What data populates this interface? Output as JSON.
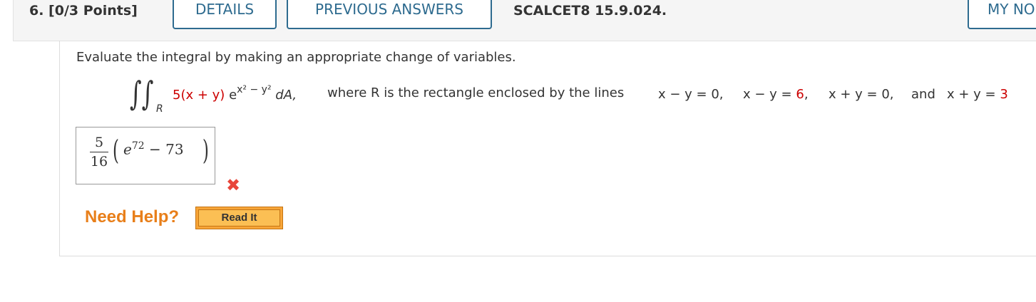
{
  "question": {
    "number_points": "6.  [0/3 Points]",
    "details_label": "DETAILS",
    "previous_answers_label": "PREVIOUS ANSWERS",
    "source": "SCALCET8 15.9.024.",
    "my_notes_label": "MY NO"
  },
  "problem": {
    "prompt": "Evaluate the integral by making an appropriate change of variables.",
    "integral_subscript": "R",
    "integrand_coef": "5(x + y)",
    "integrand_e": "e",
    "integrand_exp": "x² − y²",
    "integrand_dA": " dA,",
    "where_text": "where R is the rectangle enclosed by the lines",
    "line1": "x − y = 0,",
    "line2_left": "x − y = ",
    "line2_value": "6",
    "line2_comma": ",",
    "line3": "x + y = 0,",
    "and_text": "and",
    "line4_left": "x + y = ",
    "line4_value": "3"
  },
  "answer": {
    "frac_num": "5",
    "frac_den": "16",
    "e": "e",
    "exp": "72",
    "rest": " − 73",
    "status": "incorrect"
  },
  "help": {
    "need_help_label": "Need Help?",
    "read_it_label": "Read It"
  },
  "colors": {
    "accent_blue": "#2e6b8f",
    "given_value_red": "#cc0000",
    "incorrect_mark": "#e8463b",
    "help_orange": "#e87f1a"
  }
}
